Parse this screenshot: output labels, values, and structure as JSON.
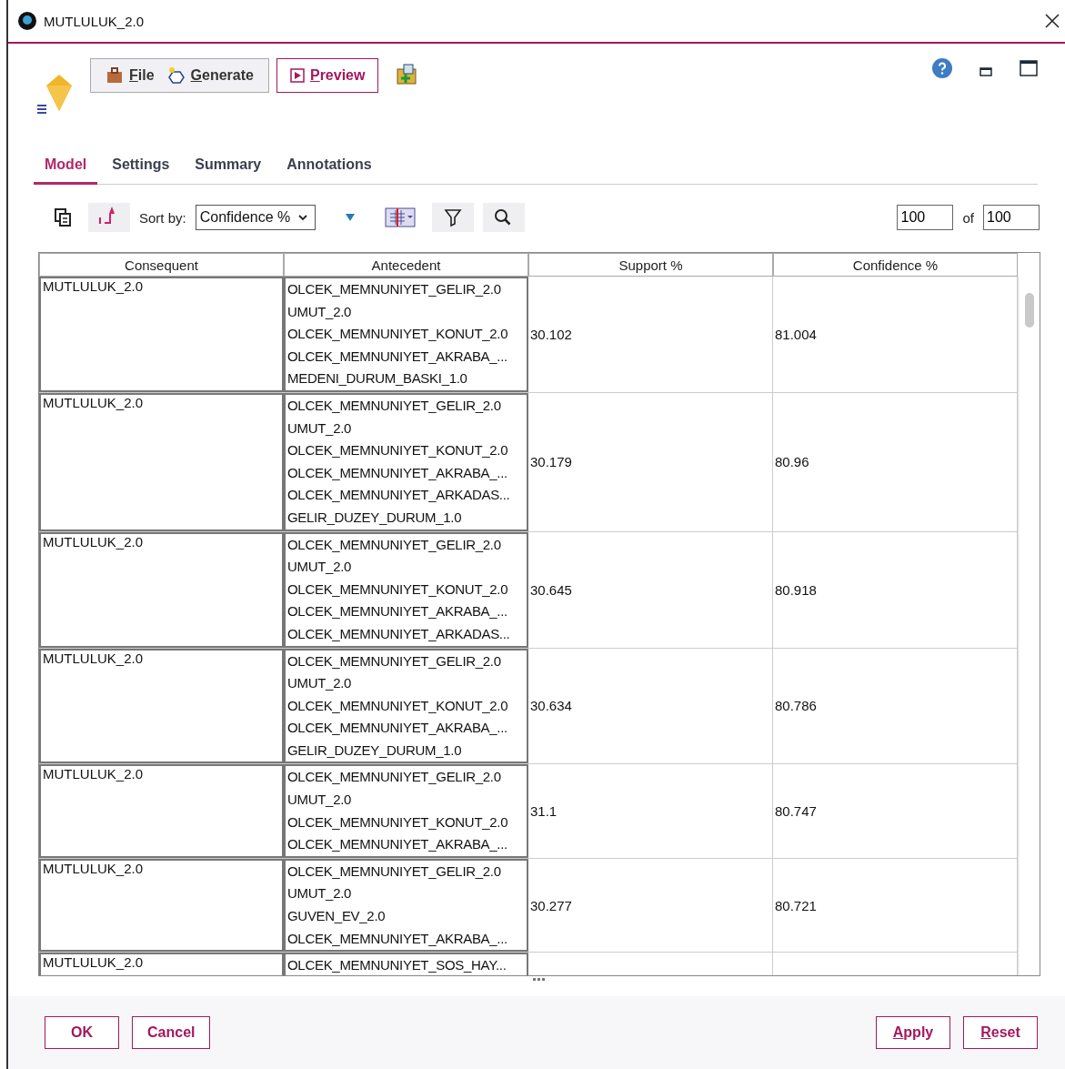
{
  "window": {
    "title": "MUTLULUK_2.0"
  },
  "toolbar": {
    "menus": [
      {
        "label": "File"
      },
      {
        "label": "Generate"
      }
    ],
    "preview": "Preview"
  },
  "tabs": [
    {
      "label": "Model",
      "selected": true
    },
    {
      "label": "Settings",
      "selected": false
    },
    {
      "label": "Summary",
      "selected": false
    },
    {
      "label": "Annotations",
      "selected": false
    }
  ],
  "sort": {
    "label": "Sort by:",
    "value": "Confidence %"
  },
  "paging": {
    "shown": "100",
    "of": "of",
    "total": "100"
  },
  "table": {
    "columns": [
      "Consequent",
      "Antecedent",
      "Support %",
      "Confidence %"
    ],
    "rows": [
      {
        "consequent": "MUTLULUK_2.0",
        "antecedent": [
          "OLCEK_MEMNUNIYET_GELIR_2.0",
          "UMUT_2.0",
          "OLCEK_MEMNUNIYET_KONUT_2.0",
          "OLCEK_MEMNUNIYET_AKRABA_...",
          "MEDENI_DURUM_BASKI_1.0"
        ],
        "support": "30.102",
        "confidence": "81.004"
      },
      {
        "consequent": "MUTLULUK_2.0",
        "antecedent": [
          "OLCEK_MEMNUNIYET_GELIR_2.0",
          "UMUT_2.0",
          "OLCEK_MEMNUNIYET_KONUT_2.0",
          "OLCEK_MEMNUNIYET_AKRABA_...",
          "OLCEK_MEMNUNIYET_ARKADAS...",
          "GELIR_DUZEY_DURUM_1.0"
        ],
        "support": "30.179",
        "confidence": "80.96"
      },
      {
        "consequent": "MUTLULUK_2.0",
        "antecedent": [
          "OLCEK_MEMNUNIYET_GELIR_2.0",
          "UMUT_2.0",
          "OLCEK_MEMNUNIYET_KONUT_2.0",
          "OLCEK_MEMNUNIYET_AKRABA_...",
          "OLCEK_MEMNUNIYET_ARKADAS..."
        ],
        "support": "30.645",
        "confidence": "80.918"
      },
      {
        "consequent": "MUTLULUK_2.0",
        "antecedent": [
          "OLCEK_MEMNUNIYET_GELIR_2.0",
          "UMUT_2.0",
          "OLCEK_MEMNUNIYET_KONUT_2.0",
          "OLCEK_MEMNUNIYET_AKRABA_...",
          "GELIR_DUZEY_DURUM_1.0"
        ],
        "support": "30.634",
        "confidence": "80.786"
      },
      {
        "consequent": "MUTLULUK_2.0",
        "antecedent": [
          "OLCEK_MEMNUNIYET_GELIR_2.0",
          "UMUT_2.0",
          "OLCEK_MEMNUNIYET_KONUT_2.0",
          "OLCEK_MEMNUNIYET_AKRABA_..."
        ],
        "support": "31.1",
        "confidence": "80.747"
      },
      {
        "consequent": "MUTLULUK_2.0",
        "antecedent": [
          "OLCEK_MEMNUNIYET_GELIR_2.0",
          "UMUT_2.0",
          "GUVEN_EV_2.0",
          "OLCEK_MEMNUNIYET_AKRABA_..."
        ],
        "support": "30.277",
        "confidence": "80.721"
      },
      {
        "consequent": "MUTLULUK_2.0",
        "antecedent": [
          "OLCEK_MEMNUNIYET_SOS_HAY..."
        ]
      }
    ]
  },
  "footer": {
    "left": [
      "OK",
      "Cancel"
    ],
    "right": [
      "Apply",
      "Reset"
    ]
  }
}
